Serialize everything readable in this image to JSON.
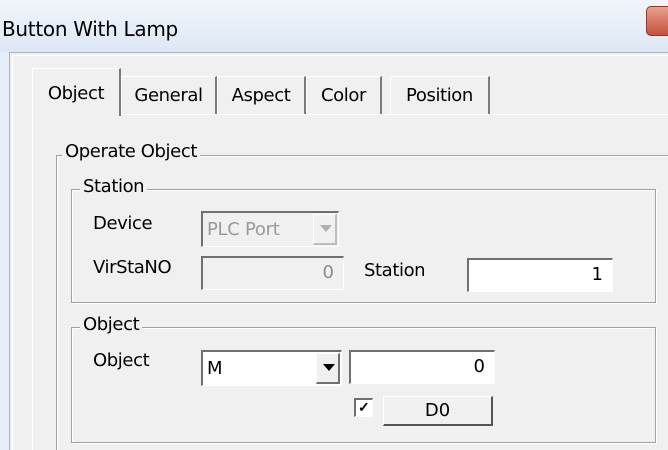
{
  "window": {
    "title": "Button With Lamp"
  },
  "tabs": [
    {
      "label": "Object",
      "active": true
    },
    {
      "label": "General",
      "active": false
    },
    {
      "label": "Aspect",
      "active": false
    },
    {
      "label": "Color",
      "active": false
    },
    {
      "label": "Position",
      "active": false
    }
  ],
  "operate_object": {
    "legend": "Operate Object",
    "station_group": {
      "legend": "Station",
      "device_label": "Device",
      "device_value": "PLC Port",
      "virstano_label": "VirStaNO",
      "virstano_value": "0",
      "station_label": "Station",
      "station_value": "1"
    },
    "object_group": {
      "legend": "Object",
      "object_label": "Object",
      "object_type": "M",
      "object_address": "0",
      "checkbox_checked": true,
      "button_label": "D0"
    }
  }
}
